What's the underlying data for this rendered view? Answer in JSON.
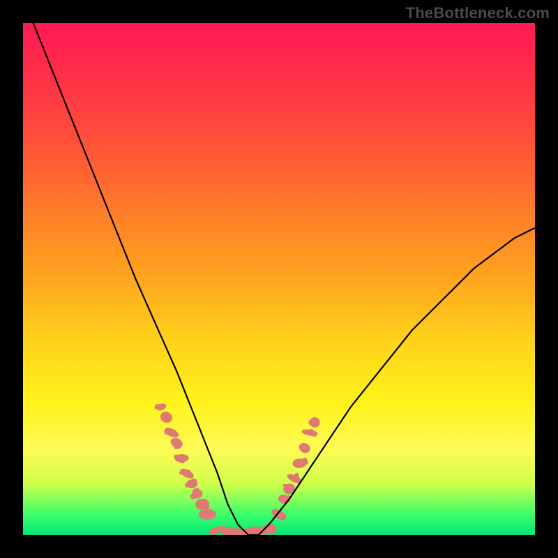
{
  "watermark": "TheBottleneck.com",
  "chart_data": {
    "type": "line",
    "title": "",
    "xlabel": "",
    "ylabel": "",
    "xlim": [
      0,
      100
    ],
    "ylim": [
      0,
      100
    ],
    "series": [
      {
        "name": "bottleneck-curve",
        "x": [
          2,
          6,
          10,
          14,
          18,
          22,
          26,
          30,
          34,
          36,
          38,
          40,
          42,
          44,
          46,
          48,
          52,
          56,
          60,
          64,
          68,
          72,
          76,
          80,
          84,
          88,
          92,
          96,
          100
        ],
        "y": [
          100,
          90,
          80,
          70,
          60,
          50,
          41,
          32,
          22,
          17,
          12,
          6,
          2,
          0,
          0,
          2,
          7,
          13,
          19,
          25,
          30,
          35,
          40,
          44,
          48,
          52,
          55,
          58,
          60
        ]
      }
    ],
    "scatter_clusters": [
      {
        "name": "left-cluster",
        "points": [
          {
            "x": 27,
            "y": 25
          },
          {
            "x": 28,
            "y": 23
          },
          {
            "x": 29,
            "y": 20
          },
          {
            "x": 30,
            "y": 18
          },
          {
            "x": 31,
            "y": 15
          },
          {
            "x": 32,
            "y": 12
          },
          {
            "x": 33,
            "y": 10
          },
          {
            "x": 34,
            "y": 8
          },
          {
            "x": 35,
            "y": 6
          },
          {
            "x": 36,
            "y": 4
          }
        ]
      },
      {
        "name": "bottom-cluster",
        "points": [
          {
            "x": 38,
            "y": 1
          },
          {
            "x": 40,
            "y": 0.6
          },
          {
            "x": 42,
            "y": 0.4
          },
          {
            "x": 43,
            "y": 0.4
          },
          {
            "x": 44,
            "y": 0.4
          },
          {
            "x": 46,
            "y": 0.6
          },
          {
            "x": 48,
            "y": 1.2
          }
        ]
      },
      {
        "name": "right-cluster",
        "points": [
          {
            "x": 50,
            "y": 4
          },
          {
            "x": 51,
            "y": 7
          },
          {
            "x": 52,
            "y": 9
          },
          {
            "x": 53,
            "y": 11
          },
          {
            "x": 54,
            "y": 14
          },
          {
            "x": 55,
            "y": 17
          },
          {
            "x": 56,
            "y": 20
          },
          {
            "x": 57,
            "y": 22
          }
        ]
      }
    ],
    "bottom_green_band_y_range": [
      0,
      3
    ]
  }
}
